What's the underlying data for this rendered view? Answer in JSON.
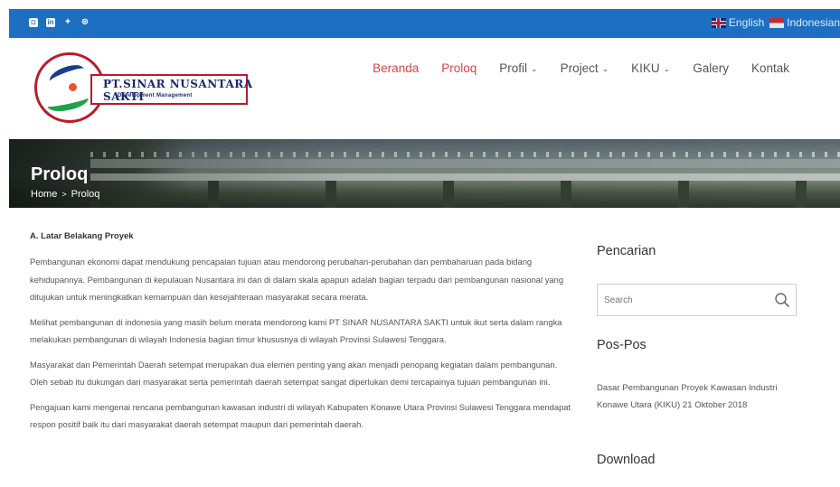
{
  "topbar": {
    "social_icons": [
      "instagram-icon",
      "linkedin-icon",
      "twitter-icon",
      "dribbble-icon"
    ],
    "lang_english": "English",
    "lang_indonesian": "Indonesian",
    "color": "#1d6fc2"
  },
  "logo": {
    "name": "PT.SINAR NUSANTARA SAKTI",
    "tagline": "Development Management"
  },
  "nav": {
    "items": [
      {
        "label": "Beranda",
        "active": true
      },
      {
        "label": "Proloq",
        "active": true
      },
      {
        "label": "Profil",
        "dropdown": true
      },
      {
        "label": "Project",
        "dropdown": true
      },
      {
        "label": "KIKU",
        "dropdown": true
      },
      {
        "label": "Galery"
      },
      {
        "label": "Kontak"
      }
    ],
    "active_color": "#d64545"
  },
  "banner": {
    "title": "Proloq",
    "breadcrumb_home": "Home",
    "breadcrumb_sep": ">",
    "breadcrumb_current": "Proloq"
  },
  "article": {
    "heading": "A. Latar Belakang Proyek",
    "paragraphs": [
      "Pembangunan ekonomi dapat mendukung pencapaian tujuan atau mendorong perubahan-perubahan dan pembaharuan pada bidang kehidupannya. Pembangunan di kepulauan Nusantara ini dan di dalam skala apapun adalah bagian terpadu dari pembangunan nasional yang ditujukan  untuk meningkatkan kemampuan dan kesejahteraan masyarakat secara merata.",
      "Melihat pembangunan di indonesia yang masih belum merata mendorong kami PT SINAR NUSANTARA SAKTI untuk ikut serta dalam rangka melakukan pembangunan di wilayah Indonesia bagian timur khususnya di wilayah Provinsi Sulawesi Tenggara.",
      "Masyarakat dan Pemerintah Daerah setempat merupakan dua elemen  penting  yang  akan menjadi penopang kegiatan dalam pembangunan. Oleh sebab  itu dukungan  dari  masyarakat serta pemerintah daerah setempat sangat diperlukan demi tercapainya tujuan pembangunan ini.",
      "Pengajuan kami mengenai  rencana  pembangunan kawasan  industri di wilayah Kabupaten Konawe Utara  Provinsi  Sulawesi Tenggara mendapat respon positif  baik itu dari  masyarakat  daerah setempat  maupun dari  pemerintah  daerah."
    ]
  },
  "sidebar": {
    "search_title": "Pencarian",
    "search_placeholder": "Search",
    "posts_title": "Pos-Pos",
    "post_link": "Dasar Pembangunan Proyek Kawasan Industri Konawe Utara (KIKU)",
    "post_date": "21 Oktober 2018",
    "download_title": "Download"
  }
}
